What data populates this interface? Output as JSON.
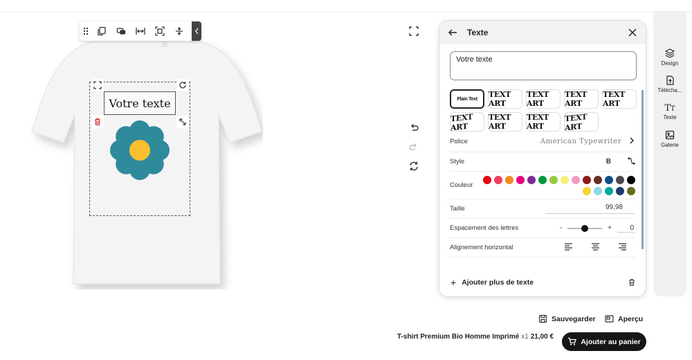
{
  "canvas": {
    "text_box_value": "Votre texte",
    "toolbar_icons": [
      "drag-grip-icon",
      "duplicate-icon",
      "layer-order-icon",
      "center-horizontal-icon",
      "fit-icon",
      "center-vertical-icon",
      "collapse-icon"
    ],
    "controls": [
      "expand-icon",
      "rotate-icon",
      "delete-icon",
      "resize-icon"
    ],
    "tshirt_color": "#f2f2f2",
    "flower": {
      "petal_color": "#2f8a9b",
      "center_color": "#fbbf2f"
    }
  },
  "panel": {
    "title": "Texte",
    "input_value": "Votre texte",
    "text_styles": [
      {
        "label": "Plain Text",
        "selected": true
      },
      {
        "label": "TEXT ART",
        "selected": false
      },
      {
        "label": "TEXT ART",
        "selected": false
      },
      {
        "label": "TEXT ART",
        "selected": false
      },
      {
        "label": "TEXT ART",
        "selected": false
      },
      {
        "label": "TEXT ART",
        "selected": false
      },
      {
        "label": "TEXT ART",
        "selected": false
      },
      {
        "label": "TEXT ART",
        "selected": false
      },
      {
        "label": "TEXT ART",
        "selected": false
      }
    ],
    "police_label": "Police",
    "police_value": "American Typewriter",
    "style_label": "Style",
    "style_bold": "B",
    "couleur_label": "Couleur",
    "colors": [
      "#e30613",
      "#ef3b5d",
      "#f08a24",
      "#e5007e",
      "#7b2a8f",
      "#009a3e",
      "#98c93c",
      "#f6f07a",
      "#f29ac2",
      "#8a1c1c",
      "#6a2c1e",
      "#0d4e8a",
      "#4a4a4a",
      "#000000",
      "#f7d437",
      "#8fd7e6",
      "#00a99d",
      "#1e3a6e",
      "#6b6b1e"
    ],
    "taille_label": "Taille",
    "taille_value": "99,98",
    "espacement_label": "Espacement des lettres",
    "espacement_minus": "-",
    "espacement_plus": "+",
    "espacement_value": "0",
    "espacement_level": 0.5,
    "alignement_label": "Alignement horizontal",
    "add_text_label": "Ajouter plus de texte"
  },
  "rail": {
    "items": [
      {
        "label": "Design",
        "icon": "layers-icon"
      },
      {
        "label": "Télécha...",
        "icon": "upload-icon"
      },
      {
        "label": "Texte",
        "icon": "text-icon"
      },
      {
        "label": "Galerie",
        "icon": "gallery-icon"
      }
    ]
  },
  "footer": {
    "save_label": "Sauvegarder",
    "preview_label": "Aperçu",
    "product_name": "T-shirt Premium Bio Homme Imprimé",
    "quantity": "x1",
    "price": "21,00 €",
    "cart_label": "Ajouter au panier"
  }
}
